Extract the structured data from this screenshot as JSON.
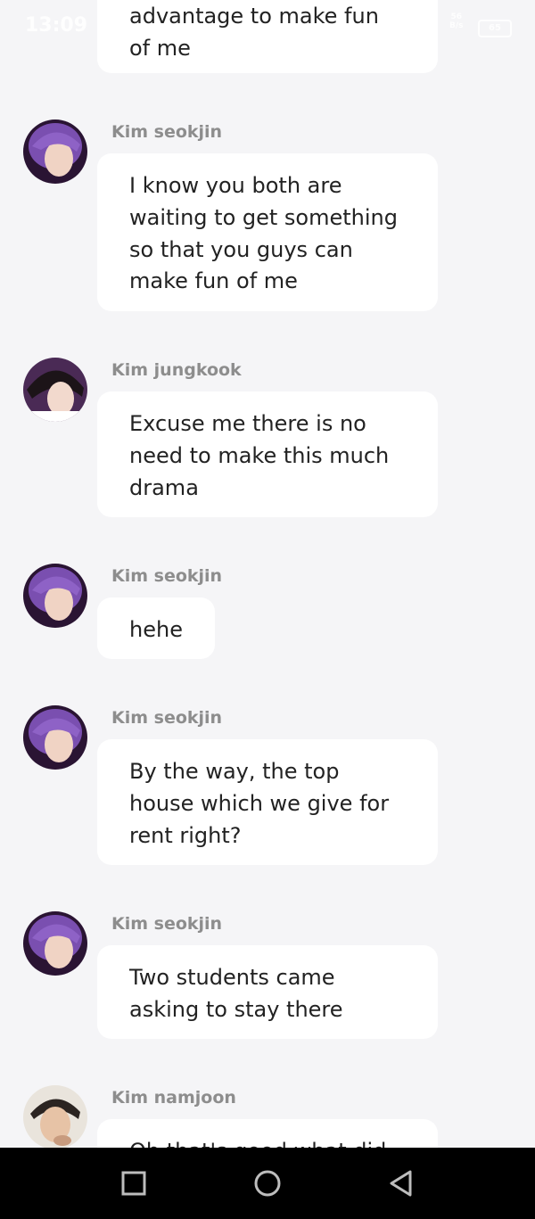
{
  "status_bar": {
    "time": "13:09",
    "network_type": "56",
    "network_speed": "B/s",
    "battery": "65"
  },
  "messages": [
    {
      "sender": "",
      "text": "advantage to make fun of me",
      "avatar": ""
    },
    {
      "sender": "Kim seokjin",
      "text": "I know you both are waiting to get something so that you guys can make fun of me",
      "avatar": "seokjin-avatar"
    },
    {
      "sender": "Kim jungkook",
      "text": "Excuse me there is no need to make this much drama",
      "avatar": "jungkook-avatar"
    },
    {
      "sender": "Kim seokjin",
      "text": "hehe",
      "avatar": "seokjin-avatar"
    },
    {
      "sender": "Kim seokjin",
      "text": "By the way, the top house which we give for rent right?",
      "avatar": "seokjin-avatar"
    },
    {
      "sender": "Kim seokjin",
      "text": "Two students came asking to stay there",
      "avatar": "seokjin-avatar"
    },
    {
      "sender": "Kim namjoon",
      "text": "Oh that's good what did",
      "avatar": "namjoon-avatar"
    }
  ],
  "nav": {
    "recent_icon": "square-icon",
    "home_icon": "circle-icon",
    "back_icon": "triangle-back-icon"
  }
}
